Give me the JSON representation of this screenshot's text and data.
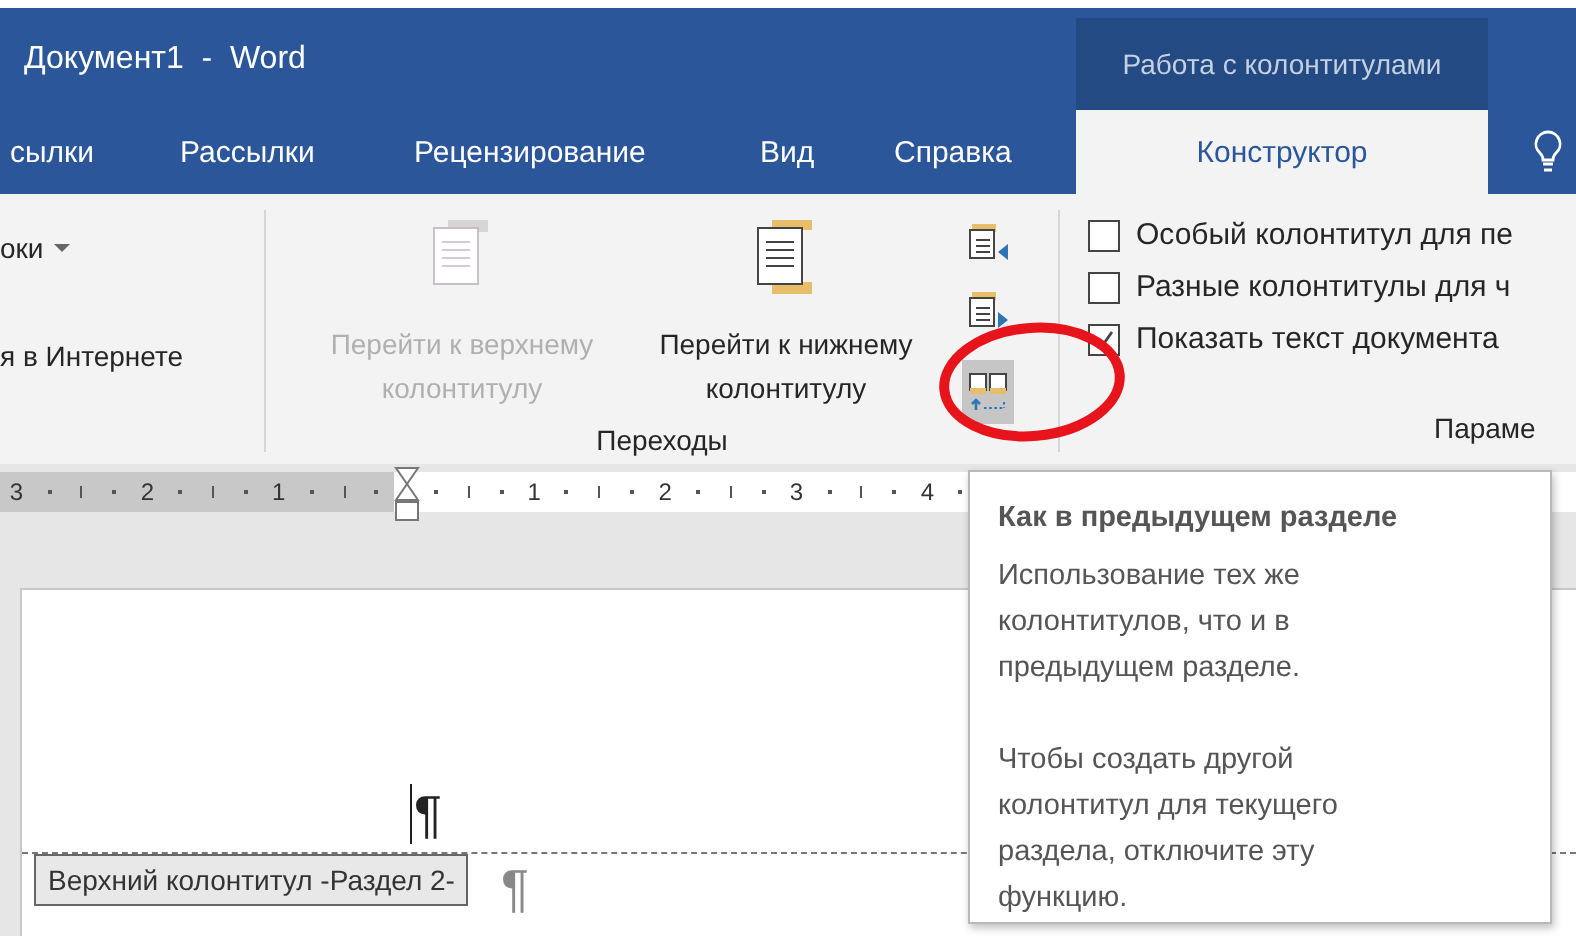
{
  "window": {
    "title": "Документ1  -  Word",
    "context_header": "Работа с колонтитулами"
  },
  "tabs": [
    {
      "label": "сылки",
      "selected": false
    },
    {
      "label": "Рассылки",
      "selected": false
    },
    {
      "label": "Рецензирование",
      "selected": false
    },
    {
      "label": "Вид",
      "selected": false
    },
    {
      "label": "Справка",
      "selected": false
    },
    {
      "label": "Конструктор",
      "selected": true
    }
  ],
  "ribbon": {
    "group_1": {
      "items": [
        "оки",
        "я в Интернете"
      ]
    },
    "navigation": {
      "label": "Переходы",
      "buttons": [
        {
          "kind": "header",
          "label": "Перейти к верхнему колонтитулу",
          "disabled": true
        },
        {
          "kind": "footer",
          "label": "Перейти к нижнему колонтитулу",
          "disabled": false
        }
      ],
      "small_buttons": [
        {
          "kind": "previous",
          "active": false
        },
        {
          "kind": "next",
          "active": false
        },
        {
          "kind": "link",
          "active": true
        }
      ]
    },
    "options": {
      "label": "Параме",
      "checkboxes": [
        {
          "label": "Особый колонтитул для пе",
          "checked": false
        },
        {
          "label": "Разные колонтитулы для ч",
          "checked": false
        },
        {
          "label": "Показать текст документа",
          "checked": true
        }
      ]
    }
  },
  "ruler": {
    "left_numbers": [
      "3",
      "2",
      "1"
    ],
    "right_numbers": [
      "1",
      "2",
      "3",
      "4"
    ]
  },
  "document": {
    "paragraph_marks": [
      "¶",
      "¶"
    ],
    "header_label": "Верхний колонтитул -Раздел 2-"
  },
  "tooltip": {
    "title": "Как в предыдущем разделе",
    "paragraphs": [
      "Использование тех же колонтитулов, что и в предыдущем разделе.",
      "Чтобы создать другой колонтитул для текущего раздела, отключите эту функцию."
    ]
  }
}
